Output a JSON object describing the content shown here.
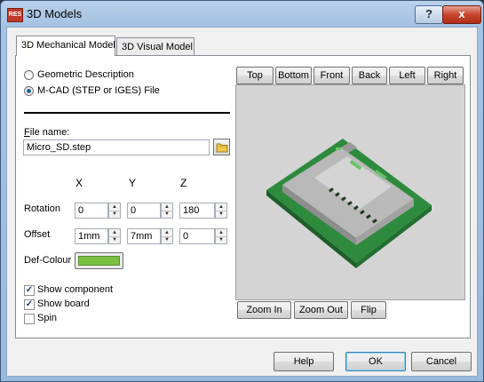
{
  "window": {
    "title": "3D Models",
    "icon_text": "RES",
    "help_label": "?",
    "close_label": "x"
  },
  "tabs": [
    {
      "label": "3D Mechanical Model",
      "active": true
    },
    {
      "label": "3D Visual Model",
      "active": false
    }
  ],
  "source": {
    "options": [
      {
        "label": "Geometric Description",
        "selected": false
      },
      {
        "label": "M-CAD (STEP or IGES) File",
        "selected": true
      }
    ]
  },
  "file": {
    "label": "File name:",
    "value": "Micro_SD.step"
  },
  "axes": {
    "x": "X",
    "y": "Y",
    "z": "Z"
  },
  "rotation": {
    "label": "Rotation",
    "x": "0",
    "y": "0",
    "z": "180"
  },
  "offset": {
    "label": "Offset",
    "x": "1mm",
    "y": "7mm",
    "z": "0"
  },
  "def_colour": {
    "label": "Def-Colour",
    "color": "#7ac142"
  },
  "options": {
    "show_component": {
      "label": "Show component",
      "checked": true
    },
    "show_board": {
      "label": "Show board",
      "checked": true
    },
    "spin": {
      "label": "Spin",
      "checked": false
    }
  },
  "view_buttons": [
    "Top",
    "Bottom",
    "Front",
    "Back",
    "Left",
    "Right"
  ],
  "zoom_buttons": [
    "Zoom In",
    "Zoom Out",
    "Flip"
  ],
  "footer": {
    "help": "Help",
    "ok": "OK",
    "cancel": "Cancel"
  },
  "colors": {
    "board": "#2e8b3e",
    "connector": "#c8c8c8",
    "viewport_bg": "#d4d4d4"
  }
}
